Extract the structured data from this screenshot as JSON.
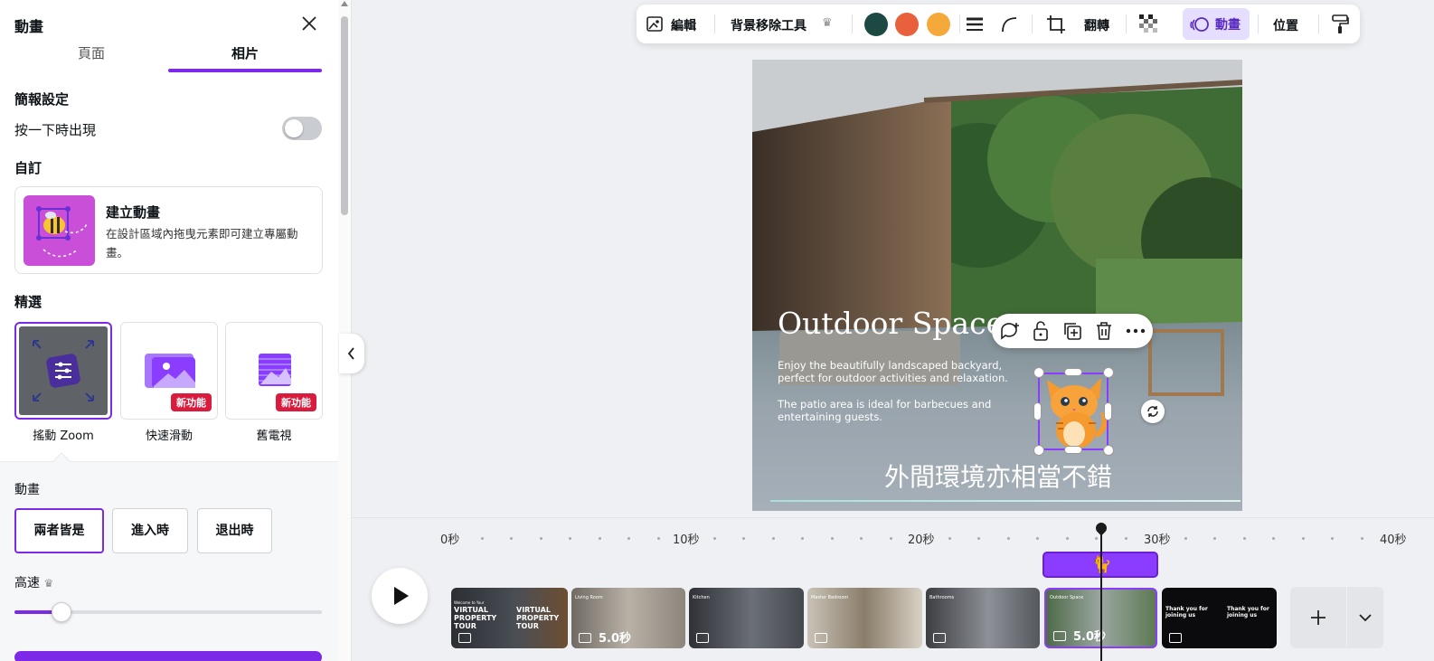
{
  "panel": {
    "title": "動畫",
    "tabs": [
      "頁面",
      "相片"
    ],
    "section_presentation": "簡報設定",
    "click_to_appear": "按一下時出現",
    "section_custom": "自訂",
    "create_title": "建立動畫",
    "create_desc": "在設計區域內拖曳元素即可建立專屬動畫。",
    "section_featured": "精選",
    "presets": [
      {
        "label": "搖動 Zoom",
        "badge": ""
      },
      {
        "label": "快速滑動",
        "badge": "新功能"
      },
      {
        "label": "舊電視",
        "badge": "新功能"
      }
    ],
    "section_animation": "動畫",
    "modes": [
      "兩者皆是",
      "進入時",
      "退出時"
    ],
    "speed_label": "高速",
    "speed_value": 0.15
  },
  "toolbar": {
    "edit": "編輯",
    "bg_remove": "背景移除工具",
    "flip": "翻轉",
    "animate": "動畫",
    "position": "位置",
    "colors": [
      "#1c4a43",
      "#e8603c",
      "#f6a93b"
    ]
  },
  "canvas": {
    "title": "Outdoor Space",
    "para1": "Enjoy the beautifully landscaped backyard, perfect for outdoor activities and relaxation.",
    "para2": "The patio area is ideal for barbecues and entertaining guests.",
    "caption": "外間環境亦相當不錯",
    "accent_color": "#8b3dff"
  },
  "timeline": {
    "ticks": [
      "0秒",
      "10秒",
      "20秒",
      "30秒",
      "40秒"
    ],
    "clips": [
      {
        "dur": ""
      },
      {
        "dur": "5.0秒"
      },
      {
        "dur": ""
      },
      {
        "dur": ""
      },
      {
        "dur": ""
      },
      {
        "dur": "5.0秒"
      },
      {
        "dur": ""
      }
    ],
    "clip_texts": {
      "clip1": "VIRTUAL PROPERTY TOUR",
      "clip1_small": "Welcome to Your",
      "clip2": "Living Room",
      "clip3": "Kitchen",
      "clip4": "Master Bedroom",
      "clip5": "Bathrooms",
      "clip6": "Outdoor Space",
      "clip7": "Thank you for joining us"
    }
  }
}
